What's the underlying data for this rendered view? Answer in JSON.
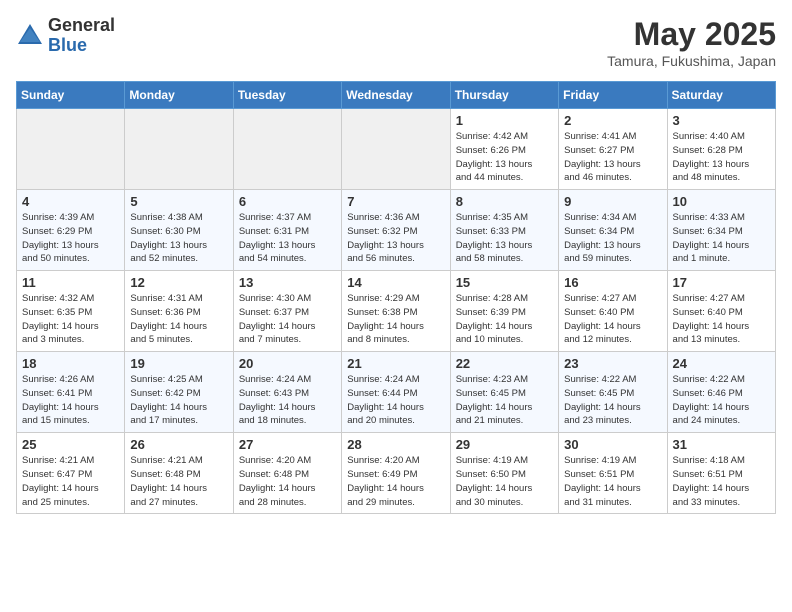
{
  "header": {
    "logo_general": "General",
    "logo_blue": "Blue",
    "title": "May 2025",
    "subtitle": "Tamura, Fukushima, Japan"
  },
  "columns": [
    "Sunday",
    "Monday",
    "Tuesday",
    "Wednesday",
    "Thursday",
    "Friday",
    "Saturday"
  ],
  "weeks": [
    [
      {
        "day": "",
        "info": ""
      },
      {
        "day": "",
        "info": ""
      },
      {
        "day": "",
        "info": ""
      },
      {
        "day": "",
        "info": ""
      },
      {
        "day": "1",
        "info": "Sunrise: 4:42 AM\nSunset: 6:26 PM\nDaylight: 13 hours\nand 44 minutes."
      },
      {
        "day": "2",
        "info": "Sunrise: 4:41 AM\nSunset: 6:27 PM\nDaylight: 13 hours\nand 46 minutes."
      },
      {
        "day": "3",
        "info": "Sunrise: 4:40 AM\nSunset: 6:28 PM\nDaylight: 13 hours\nand 48 minutes."
      }
    ],
    [
      {
        "day": "4",
        "info": "Sunrise: 4:39 AM\nSunset: 6:29 PM\nDaylight: 13 hours\nand 50 minutes."
      },
      {
        "day": "5",
        "info": "Sunrise: 4:38 AM\nSunset: 6:30 PM\nDaylight: 13 hours\nand 52 minutes."
      },
      {
        "day": "6",
        "info": "Sunrise: 4:37 AM\nSunset: 6:31 PM\nDaylight: 13 hours\nand 54 minutes."
      },
      {
        "day": "7",
        "info": "Sunrise: 4:36 AM\nSunset: 6:32 PM\nDaylight: 13 hours\nand 56 minutes."
      },
      {
        "day": "8",
        "info": "Sunrise: 4:35 AM\nSunset: 6:33 PM\nDaylight: 13 hours\nand 58 minutes."
      },
      {
        "day": "9",
        "info": "Sunrise: 4:34 AM\nSunset: 6:34 PM\nDaylight: 13 hours\nand 59 minutes."
      },
      {
        "day": "10",
        "info": "Sunrise: 4:33 AM\nSunset: 6:34 PM\nDaylight: 14 hours\nand 1 minute."
      }
    ],
    [
      {
        "day": "11",
        "info": "Sunrise: 4:32 AM\nSunset: 6:35 PM\nDaylight: 14 hours\nand 3 minutes."
      },
      {
        "day": "12",
        "info": "Sunrise: 4:31 AM\nSunset: 6:36 PM\nDaylight: 14 hours\nand 5 minutes."
      },
      {
        "day": "13",
        "info": "Sunrise: 4:30 AM\nSunset: 6:37 PM\nDaylight: 14 hours\nand 7 minutes."
      },
      {
        "day": "14",
        "info": "Sunrise: 4:29 AM\nSunset: 6:38 PM\nDaylight: 14 hours\nand 8 minutes."
      },
      {
        "day": "15",
        "info": "Sunrise: 4:28 AM\nSunset: 6:39 PM\nDaylight: 14 hours\nand 10 minutes."
      },
      {
        "day": "16",
        "info": "Sunrise: 4:27 AM\nSunset: 6:40 PM\nDaylight: 14 hours\nand 12 minutes."
      },
      {
        "day": "17",
        "info": "Sunrise: 4:27 AM\nSunset: 6:40 PM\nDaylight: 14 hours\nand 13 minutes."
      }
    ],
    [
      {
        "day": "18",
        "info": "Sunrise: 4:26 AM\nSunset: 6:41 PM\nDaylight: 14 hours\nand 15 minutes."
      },
      {
        "day": "19",
        "info": "Sunrise: 4:25 AM\nSunset: 6:42 PM\nDaylight: 14 hours\nand 17 minutes."
      },
      {
        "day": "20",
        "info": "Sunrise: 4:24 AM\nSunset: 6:43 PM\nDaylight: 14 hours\nand 18 minutes."
      },
      {
        "day": "21",
        "info": "Sunrise: 4:24 AM\nSunset: 6:44 PM\nDaylight: 14 hours\nand 20 minutes."
      },
      {
        "day": "22",
        "info": "Sunrise: 4:23 AM\nSunset: 6:45 PM\nDaylight: 14 hours\nand 21 minutes."
      },
      {
        "day": "23",
        "info": "Sunrise: 4:22 AM\nSunset: 6:45 PM\nDaylight: 14 hours\nand 23 minutes."
      },
      {
        "day": "24",
        "info": "Sunrise: 4:22 AM\nSunset: 6:46 PM\nDaylight: 14 hours\nand 24 minutes."
      }
    ],
    [
      {
        "day": "25",
        "info": "Sunrise: 4:21 AM\nSunset: 6:47 PM\nDaylight: 14 hours\nand 25 minutes."
      },
      {
        "day": "26",
        "info": "Sunrise: 4:21 AM\nSunset: 6:48 PM\nDaylight: 14 hours\nand 27 minutes."
      },
      {
        "day": "27",
        "info": "Sunrise: 4:20 AM\nSunset: 6:48 PM\nDaylight: 14 hours\nand 28 minutes."
      },
      {
        "day": "28",
        "info": "Sunrise: 4:20 AM\nSunset: 6:49 PM\nDaylight: 14 hours\nand 29 minutes."
      },
      {
        "day": "29",
        "info": "Sunrise: 4:19 AM\nSunset: 6:50 PM\nDaylight: 14 hours\nand 30 minutes."
      },
      {
        "day": "30",
        "info": "Sunrise: 4:19 AM\nSunset: 6:51 PM\nDaylight: 14 hours\nand 31 minutes."
      },
      {
        "day": "31",
        "info": "Sunrise: 4:18 AM\nSunset: 6:51 PM\nDaylight: 14 hours\nand 33 minutes."
      }
    ]
  ]
}
